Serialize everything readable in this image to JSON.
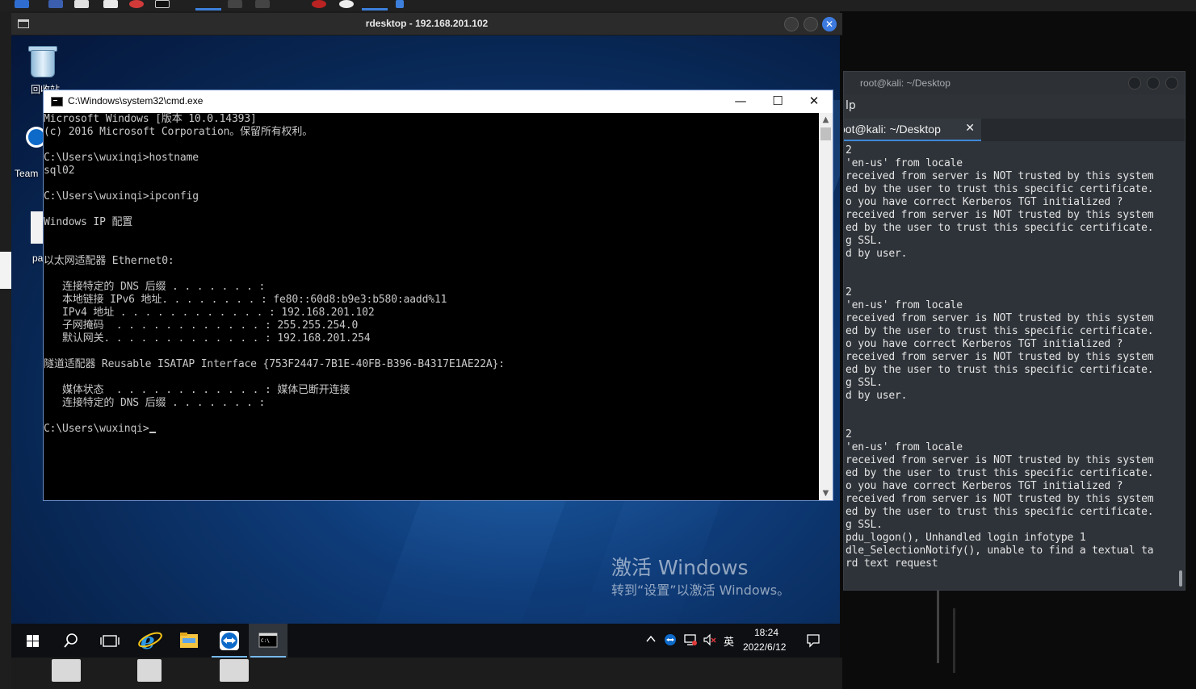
{
  "rdesktop": {
    "title": "rdesktop - 192.168.201.102"
  },
  "desktop": {
    "recycle_bin_label": "回收站",
    "teamviewer_label": "Team",
    "pa_label": "pa"
  },
  "cmd": {
    "title": "C:\\Windows\\system32\\cmd.exe",
    "lines": [
      "Microsoft Windows [版本 10.0.14393]",
      "(c) 2016 Microsoft Corporation。保留所有权利。",
      "",
      "C:\\Users\\wuxinqi>hostname",
      "sql02",
      "",
      "C:\\Users\\wuxinqi>ipconfig",
      "",
      "Windows IP 配置",
      "",
      "",
      "以太网适配器 Ethernet0:",
      "",
      "   连接特定的 DNS 后缀 . . . . . . . :",
      "   本地链接 IPv6 地址. . . . . . . . : fe80::60d8:b9e3:b580:aadd%11",
      "   IPv4 地址 . . . . . . . . . . . . : 192.168.201.102",
      "   子网掩码  . . . . . . . . . . . . : 255.255.254.0",
      "   默认网关. . . . . . . . . . . . . : 192.168.201.254",
      "",
      "隧道适配器 Reusable ISATAP Interface {753F2447-7B1E-40FB-B396-B4317E1AE22A}:",
      "",
      "   媒体状态  . . . . . . . . . . . . : 媒体已断开连接",
      "   连接特定的 DNS 后缀 . . . . . . . :",
      ""
    ],
    "prompt": "C:\\Users\\wuxinqi>",
    "minimize_glyph": "—",
    "maximize_glyph": "☐",
    "close_glyph": "✕"
  },
  "watermark": {
    "line1": "激活 Windows",
    "line2": "转到“设置”以激活 Windows。"
  },
  "taskbar": {
    "time": "18:24",
    "date": "2022/6/12",
    "ime": "英",
    "apps": [
      "start-icon",
      "search-icon",
      "task-view-icon",
      "ie-icon",
      "file-explorer-icon",
      "teamviewer-icon",
      "cmd-icon"
    ]
  },
  "kali": {
    "title": "root@kali: ~/Desktop",
    "menu_help": "lp",
    "tab_label": "oot@kali: ~/Desktop",
    "tab_close": "✕",
    "lines": [
      "2",
      "'en-us' from locale",
      "received from server is NOT trusted by this system",
      "ed by the user to trust this specific certificate.",
      "o you have correct Kerberos TGT initialized ?",
      "received from server is NOT trusted by this system",
      "ed by the user to trust this specific certificate.",
      "g SSL.",
      "d by user.",
      "",
      "",
      "2",
      "'en-us' from locale",
      "received from server is NOT trusted by this system",
      "ed by the user to trust this specific certificate.",
      "o you have correct Kerberos TGT initialized ?",
      "received from server is NOT trusted by this system",
      "ed by the user to trust this specific certificate.",
      "g SSL.",
      "d by user.",
      "",
      "",
      "2",
      "'en-us' from locale",
      "received from server is NOT trusted by this system",
      "ed by the user to trust this specific certificate.",
      "o you have correct Kerberos TGT initialized ?",
      "received from server is NOT trusted by this system",
      "ed by the user to trust this specific certificate.",
      "g SSL.",
      "pdu_logon(), Unhandled login infotype 1",
      "dle_SelectionNotify(), unable to find a textual ta",
      "rd text request"
    ]
  },
  "colors": {
    "cmd_text": "#c8c8c8",
    "kali_bg": "#2e3339",
    "accent": "#3d7ae0"
  }
}
